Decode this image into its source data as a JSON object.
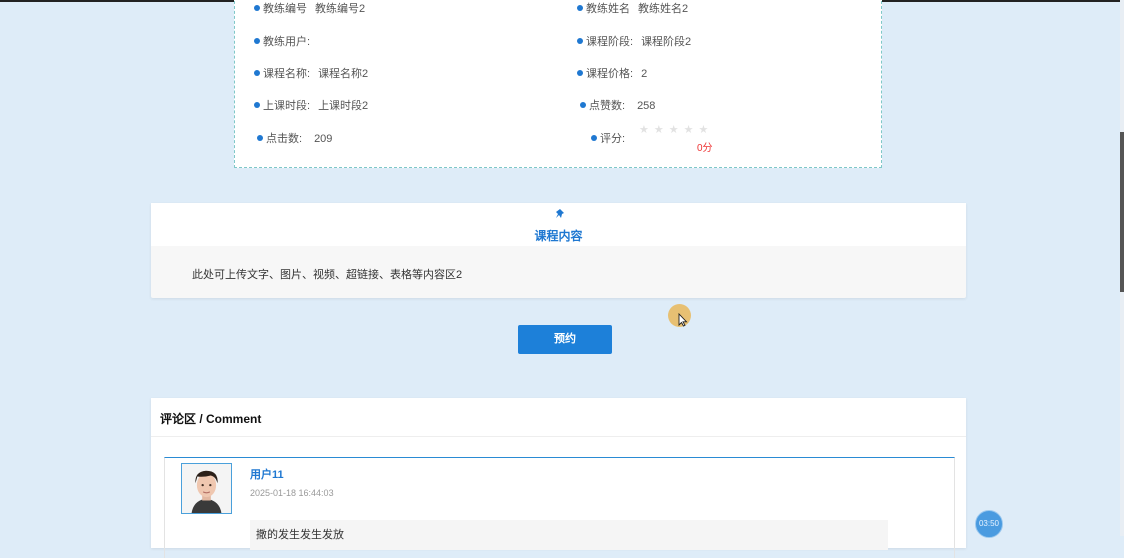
{
  "info": {
    "teacher_no_label": "教练编号",
    "teacher_no_value": "教练编号2",
    "teacher_name_label": "教练姓名",
    "teacher_name_value": "教练姓名2",
    "teacher_user_label": "教练用户:",
    "course_stage_label": "课程阶段:",
    "course_stage_value": "课程阶段2",
    "course_name_label": "课程名称:",
    "course_name_value": "课程名称2",
    "course_price_label": "课程价格:",
    "course_price_value": "2",
    "class_time_label": "上课时段:",
    "class_time_value": "上课时段2",
    "likes_label": "点赞数:",
    "likes_value": "258",
    "clicks_label": "点击数:",
    "clicks_value": "209",
    "rating_label": "评分:",
    "rating_stars": "★★★★★",
    "rating_score": "0分",
    "rating_value": 0
  },
  "content": {
    "title": "课程内容",
    "text": "此处可上传文字、图片、视频、超链接、表格等内容区2"
  },
  "actions": {
    "book_label": "预约"
  },
  "comments": {
    "header": "评论区 / Comment",
    "items": [
      {
        "user": "用户11",
        "time": "2025-01-18 16:44:03",
        "text": "撒的发生发生发放"
      }
    ]
  },
  "overlay": {
    "timer": "03:50"
  },
  "colors": {
    "accent": "#1d80d9",
    "background": "#deecf8",
    "score": "#ee3333"
  }
}
